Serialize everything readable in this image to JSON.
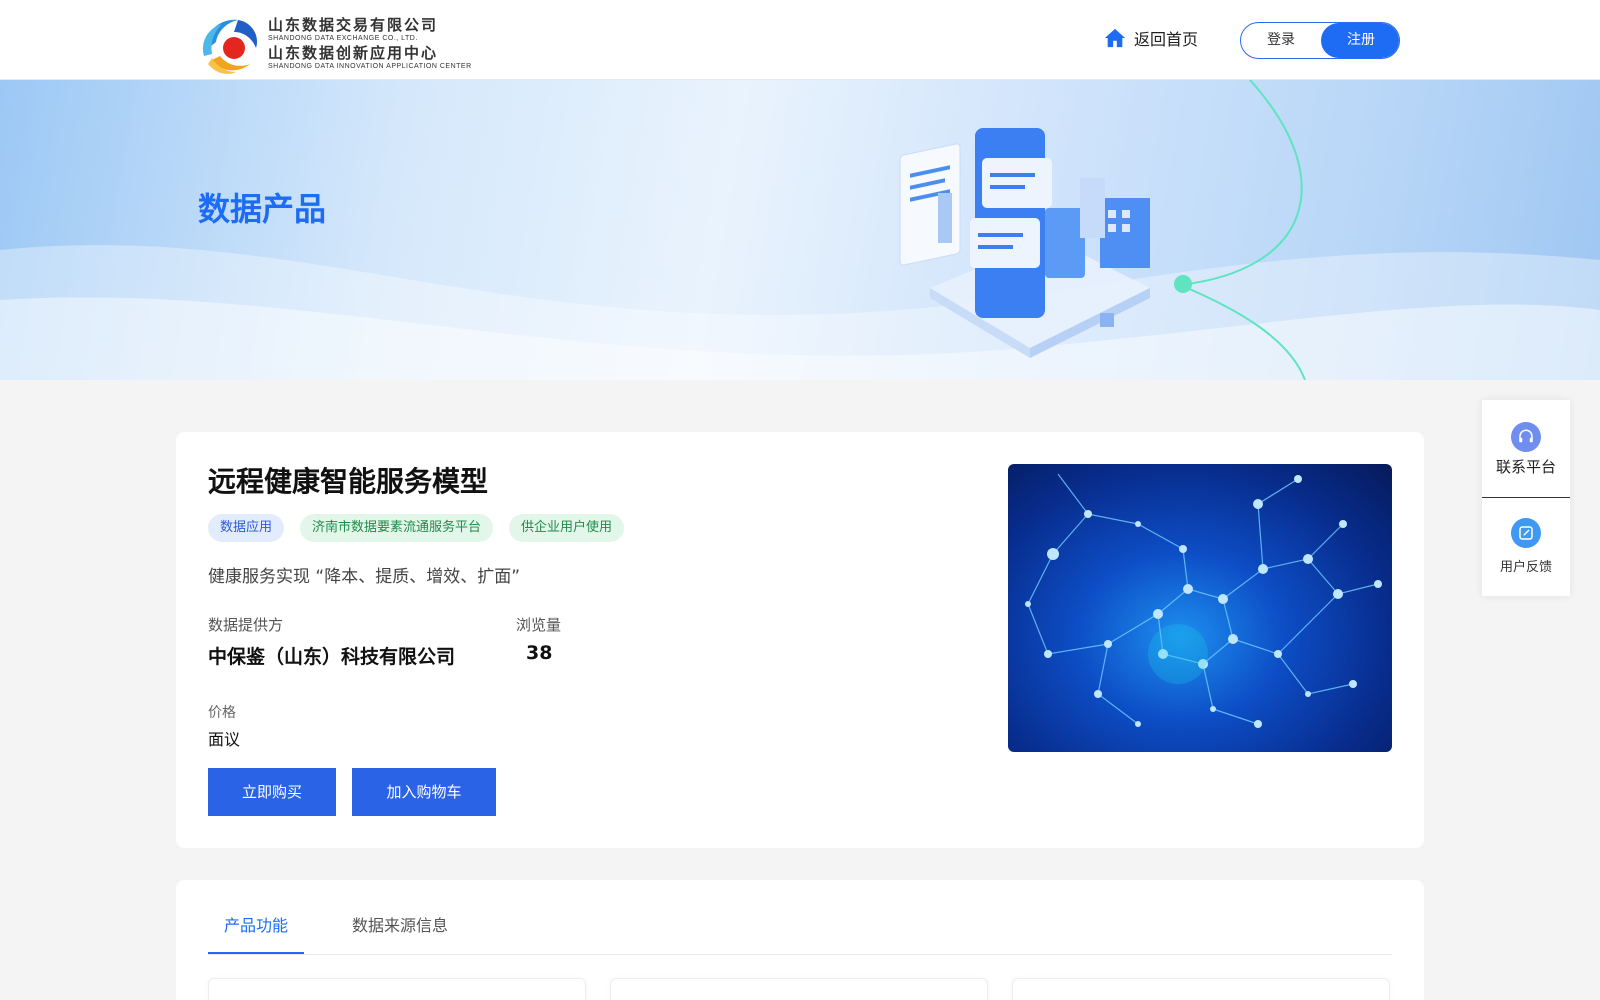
{
  "header": {
    "logo_cn_1": "山东数据交易有限公司",
    "logo_en_1": "SHANDONG DATA EXCHANGE CO., LTD.",
    "logo_cn_2": "山东数据创新应用中心",
    "logo_en_2": "SHANDONG DATA INNOVATION APPLICATION CENTER",
    "home_label": "返回首页",
    "login_label": "登录",
    "register_label": "注册"
  },
  "banner": {
    "title": "数据产品"
  },
  "product": {
    "title": "远程健康智能服务模型",
    "tags": [
      {
        "label": "数据应用",
        "style": "blue"
      },
      {
        "label": "济南市数据要素流通服务平台",
        "style": "green"
      },
      {
        "label": "供企业用户使用",
        "style": "green"
      }
    ],
    "description": "健康服务实现 “降本、提质、增效、扩面”",
    "provider_label": "数据提供方",
    "provider_value": "中保鉴（山东）科技有限公司",
    "views_label": "浏览量",
    "views_value": "38",
    "price_label": "价格",
    "price_value": "面议",
    "buy_label": "立即购买",
    "cart_label": "加入购物车"
  },
  "tabs": [
    {
      "label": "产品功能",
      "active": true
    },
    {
      "label": "数据来源信息",
      "active": false
    }
  ],
  "side": {
    "contact_label": "联系平台",
    "feedback_label": "用户反馈"
  },
  "colors": {
    "brand": "#1d6cf3",
    "button": "#2b63e6",
    "tag_blue_bg": "#e3ecfd",
    "tag_green_bg": "#e2f7ea"
  }
}
